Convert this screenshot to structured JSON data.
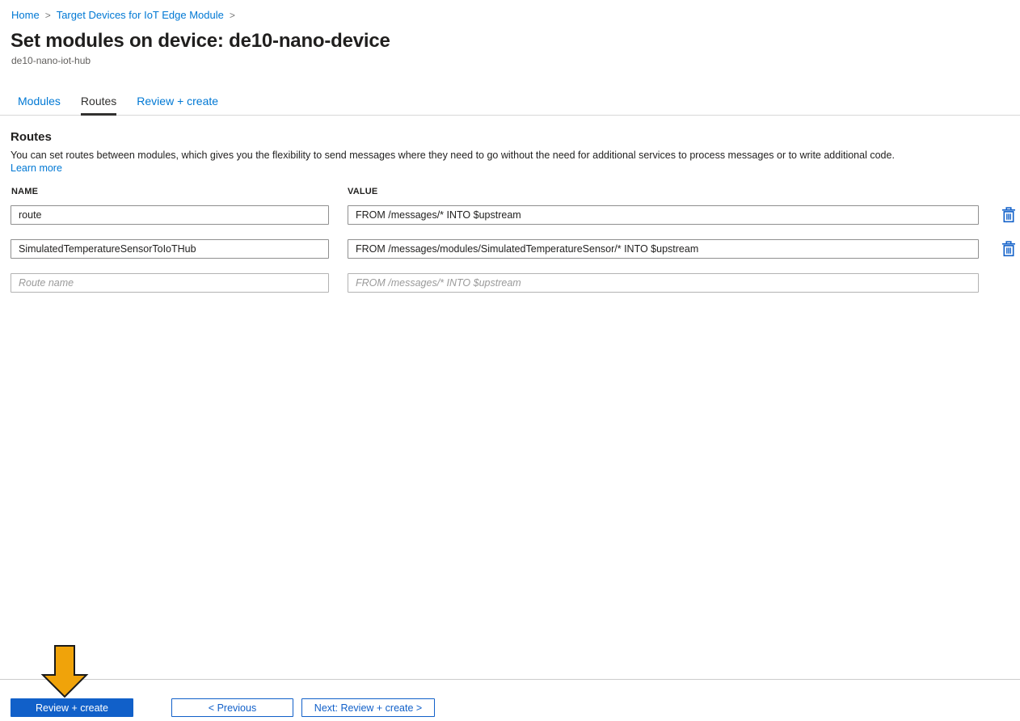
{
  "breadcrumb": {
    "items": [
      "Home",
      "Target Devices for IoT Edge Module"
    ],
    "separator": ">"
  },
  "header": {
    "title": "Set modules on device: de10-nano-device",
    "subtitle": "de10-nano-iot-hub"
  },
  "tabs": [
    {
      "label": "Modules",
      "active": false
    },
    {
      "label": "Routes",
      "active": true
    },
    {
      "label": "Review + create",
      "active": false
    }
  ],
  "routes": {
    "heading": "Routes",
    "description": "You can set routes between modules, which gives you the flexibility to send messages where they need to go without the need for additional services to process messages or to write additional code.",
    "learn_more": "Learn more",
    "columns": {
      "name": "NAME",
      "value": "VALUE"
    },
    "rows": [
      {
        "name": "route",
        "value": "FROM /messages/* INTO $upstream"
      },
      {
        "name": "SimulatedTemperatureSensorToIoTHub",
        "value": "FROM /messages/modules/SimulatedTemperatureSensor/* INTO $upstream"
      },
      {
        "name_placeholder": "Route name",
        "value_placeholder": "FROM /messages/* INTO $upstream"
      }
    ]
  },
  "footer": {
    "review_create": "Review + create",
    "previous": "< Previous",
    "next": "Next: Review + create >"
  },
  "colors": {
    "link_blue": "#0078d4",
    "primary_button_blue": "#1160c9",
    "active_tab": "#323130",
    "arrow_gold": "#f0a30a",
    "arrow_outline": "#1a1a1a"
  }
}
